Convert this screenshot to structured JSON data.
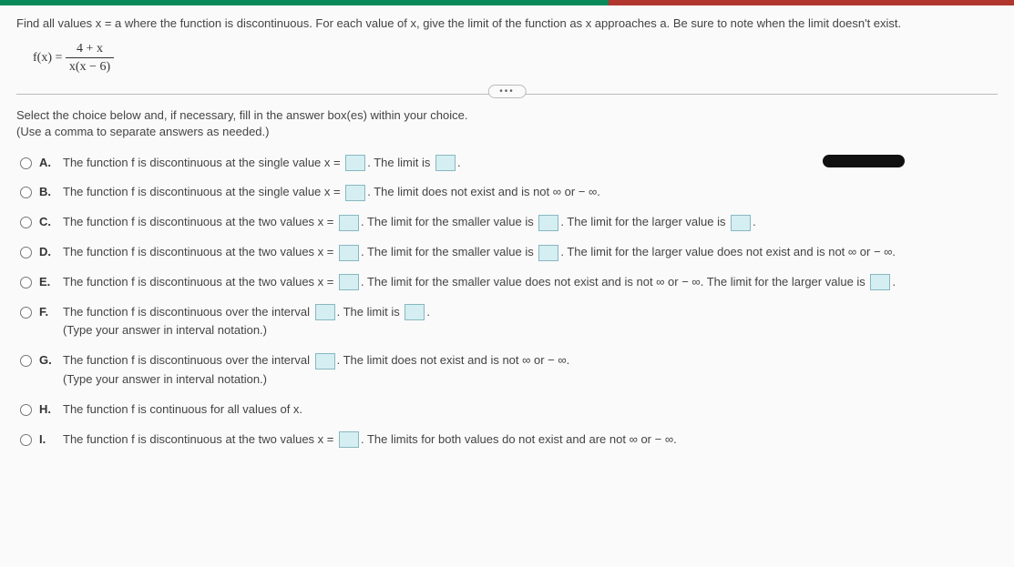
{
  "prompt": "Find all values x = a where the function is discontinuous. For each value of x, give the limit of the function as x approaches a. Be sure to note when the limit doesn't exist.",
  "formula": {
    "lhs": "f(x) =",
    "num": "4 + x",
    "den": "x(x − 6)"
  },
  "dots": "•••",
  "instruction_l1": "Select the choice below and, if necessary, fill in the answer box(es) within your choice.",
  "instruction_l2": "(Use a comma to separate answers as needed.)",
  "choices": {
    "A": {
      "t1": "The function f is discontinuous at the single value x = ",
      "t2": ". The limit is ",
      "t3": "."
    },
    "B": {
      "t1": "The function f is discontinuous at the single value x = ",
      "t2": ". The limit does not exist and is not ∞ or − ∞."
    },
    "C": {
      "t1": "The function f is discontinuous at the two values x = ",
      "t2": ". The limit for the smaller value is ",
      "t3": ". The limit for the larger value is ",
      "t4": "."
    },
    "D": {
      "t1": "The function f is discontinuous at the two values x = ",
      "t2": ". The limit for the smaller value is ",
      "t3": ". The limit for the larger value does not exist and is not ∞ or − ∞."
    },
    "E": {
      "t1": "The function f is discontinuous at the two values x = ",
      "t2": ". The limit for the smaller value does not exist and is not ∞ or − ∞. The limit for the larger value is ",
      "t3": "."
    },
    "F": {
      "t1": "The function f is discontinuous over the interval ",
      "t2": ". The limit is ",
      "t3": ".",
      "note": "(Type your answer in interval notation.)"
    },
    "G": {
      "t1": "The function f is discontinuous over the interval ",
      "t2": ". The limit does not exist and is not ∞ or − ∞.",
      "note": "(Type your answer in interval notation.)"
    },
    "H": {
      "t1": "The function f is continuous for all values of x."
    },
    "I": {
      "t1": "The function f is discontinuous at the two values x = ",
      "t2": ". The limits for both values do not exist and are not ∞ or − ∞."
    }
  },
  "letters": {
    "A": "A.",
    "B": "B.",
    "C": "C.",
    "D": "D.",
    "E": "E.",
    "F": "F.",
    "G": "G.",
    "H": "H.",
    "I": "I."
  }
}
